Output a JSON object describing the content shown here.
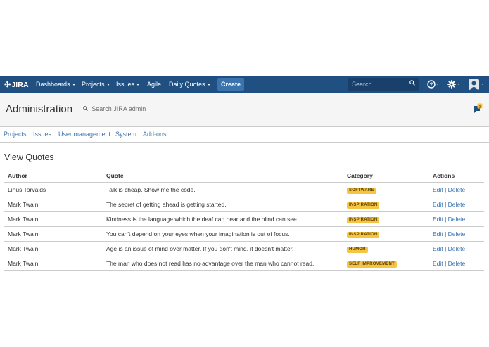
{
  "nav": {
    "logo": "JIRA",
    "items": [
      {
        "label": "Dashboards",
        "dropdown": true
      },
      {
        "label": "Projects",
        "dropdown": true
      },
      {
        "label": "Issues",
        "dropdown": true
      },
      {
        "label": "Agile",
        "dropdown": false
      },
      {
        "label": "Daily Quotes",
        "dropdown": true
      }
    ],
    "create_label": "Create",
    "search_placeholder": "Search",
    "icons": [
      "help-icon",
      "gear-icon",
      "avatar-icon"
    ]
  },
  "admin": {
    "title": "Administration",
    "search_placeholder": "Search JIRA admin",
    "notification_count": "1",
    "tabs": [
      "Projects",
      "Issues",
      "User management",
      "System",
      "Add-ons"
    ]
  },
  "page": {
    "title": "View Quotes",
    "columns": [
      "Author",
      "Quote",
      "Category",
      "Actions"
    ],
    "rows": [
      {
        "author": "Linus Torvalds",
        "quote": "Talk is cheap. Show me the code.",
        "category": "SOFTWARE",
        "edit": "Edit",
        "sep": "|",
        "delete": "Delete"
      },
      {
        "author": "Mark Twain",
        "quote": "The secret of getting ahead is getting started.",
        "category": "INSPIRATION",
        "edit": "Edit",
        "sep": "|",
        "delete": "Delete"
      },
      {
        "author": "Mark Twain",
        "quote": "Kindness is the language which the deaf can hear and the blind can see.",
        "category": "INSPIRATION",
        "edit": "Edit",
        "sep": "|",
        "delete": "Delete"
      },
      {
        "author": "Mark Twain",
        "quote": "You can't depend on your eyes when your imagination is out of focus.",
        "category": "INSPIRATION",
        "edit": "Edit",
        "sep": "|",
        "delete": "Delete"
      },
      {
        "author": "Mark Twain",
        "quote": "Age is an issue of mind over matter. If you don't mind, it doesn't matter.",
        "category": "HUMOR",
        "edit": "Edit",
        "sep": "|",
        "delete": "Delete"
      },
      {
        "author": "Mark Twain",
        "quote": "The man who does not read has no advantage over the man who cannot read.",
        "category": "SELF IMPROVEMENT",
        "edit": "Edit",
        "sep": "|",
        "delete": "Delete"
      }
    ]
  },
  "colors": {
    "nav_bg": "#205081",
    "create_bg": "#3b73af",
    "link": "#3b73af",
    "badge_bg": "#f6c342",
    "badge_text": "#594300",
    "notif": "#f6c342"
  }
}
